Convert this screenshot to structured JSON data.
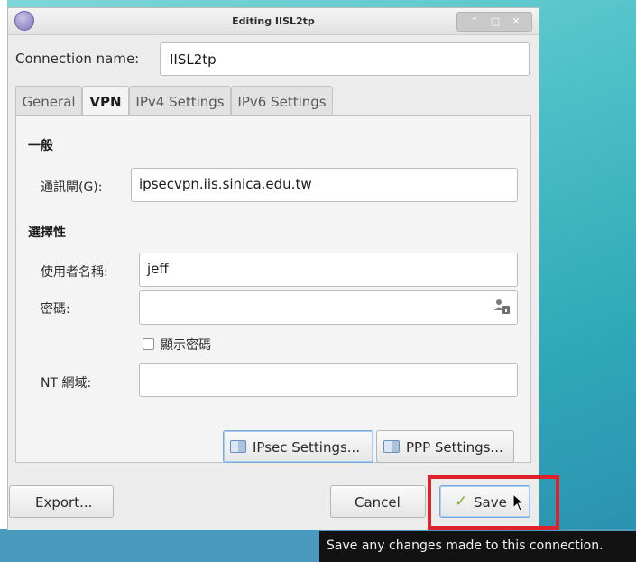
{
  "window": {
    "title": "Editing IISL2tp",
    "controls": [
      "⌃",
      "□",
      "✕"
    ]
  },
  "connection": {
    "label": "Connection name:",
    "value": "IISL2tp"
  },
  "tabs": [
    {
      "label": "General",
      "active": false
    },
    {
      "label": "VPN",
      "active": true
    },
    {
      "label": "IPv4 Settings",
      "active": false
    },
    {
      "label": "IPv6 Settings",
      "active": false
    }
  ],
  "vpn": {
    "general_heading": "一般",
    "gateway_label": "通訊閘(G):",
    "gateway_value": "ipsecvpn.iis.sinica.edu.tw",
    "optional_heading": "選擇性",
    "username_label": "使用者名稱:",
    "username_value": "jeff",
    "password_label": "密碼:",
    "password_value": "",
    "show_password_label": "顯示密碼",
    "show_password_checked": false,
    "nt_domain_label": "NT 網域:",
    "nt_domain_value": "",
    "ipsec_button": "IPsec Settings...",
    "ppp_button": "PPP Settings..."
  },
  "footer": {
    "export_button": "Export...",
    "cancel_button": "Cancel",
    "save_button": "Save"
  },
  "tooltip": "Save any changes made to this connection.",
  "colors": {
    "highlight": "#e0202a",
    "desktop": "#4fc2c8"
  }
}
